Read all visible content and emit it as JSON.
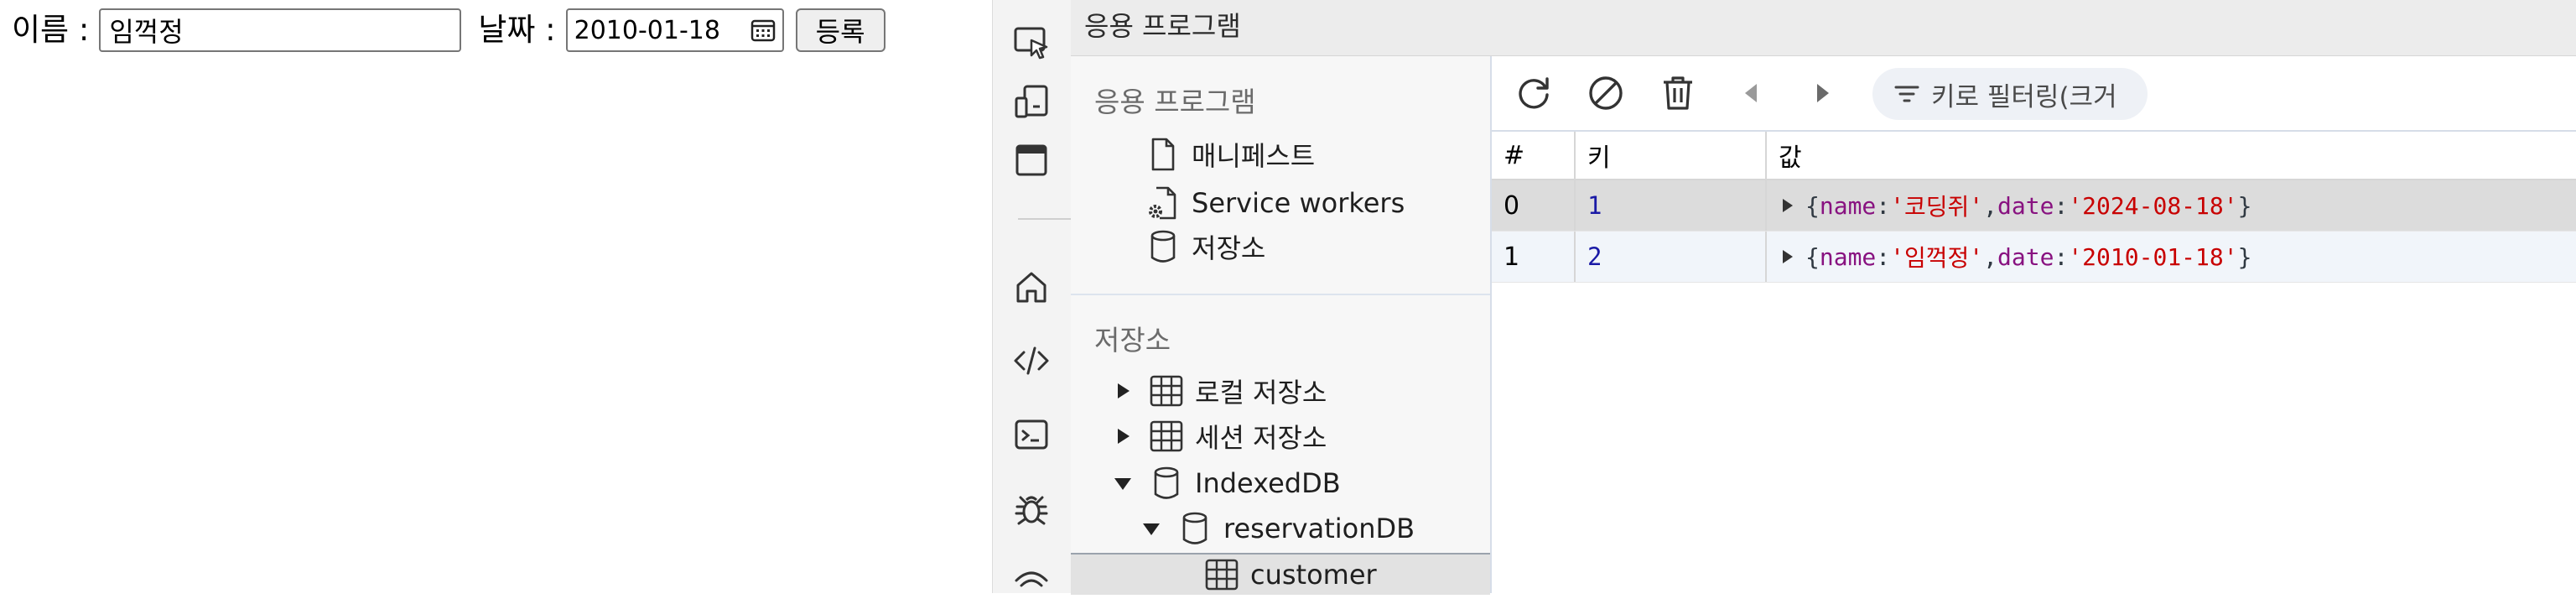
{
  "form": {
    "name_label": "이름 :",
    "name_value": "임꺽정",
    "date_label": "날짜 :",
    "date_value": "2010-01-18",
    "submit_label": "등록"
  },
  "devtools": {
    "header_title": "응용 프로그램",
    "sidebar": {
      "app_section_title": "응용 프로그램",
      "app_items": [
        "매니페스트",
        "Service workers",
        "저장소"
      ],
      "storage_section_title": "저장소",
      "storage_items": [
        "로컬 저장소",
        "세션 저장소",
        "IndexedDB",
        "reservationDB",
        "customer"
      ]
    },
    "toolbar": {
      "filter_placeholder": "키로 필터링(크거"
    },
    "table": {
      "headers": [
        "#",
        "키",
        "값"
      ],
      "rows": [
        {
          "index": "0",
          "key": "1",
          "name": "코딩쥐",
          "date": "2024-08-18"
        },
        {
          "index": "1",
          "key": "2",
          "name": "임꺽정",
          "date": "2010-01-18"
        }
      ]
    }
  }
}
